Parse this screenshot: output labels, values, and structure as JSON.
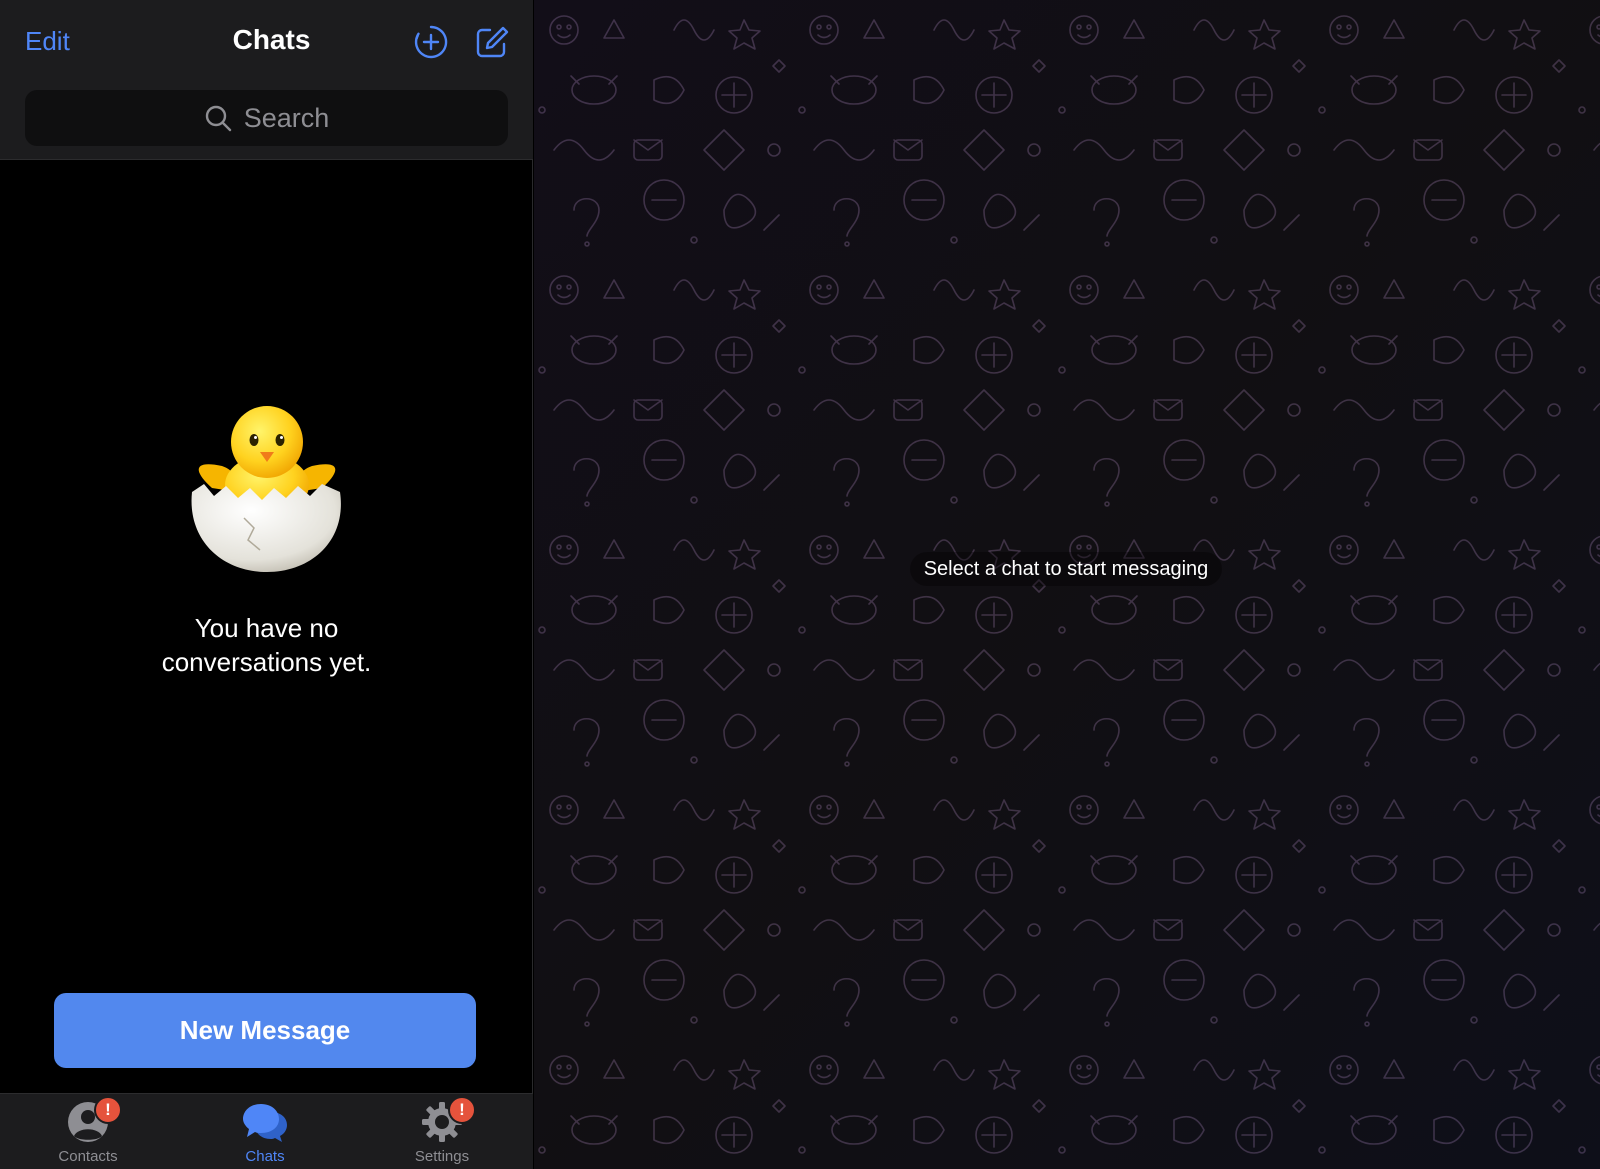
{
  "header": {
    "edit_label": "Edit",
    "title": "Chats",
    "new_story_icon": "plus-circle-icon",
    "compose_icon": "compose-icon"
  },
  "search": {
    "placeholder": "Search"
  },
  "empty_state": {
    "illustration": "hatching-chick",
    "message": "You have no\nconversations yet."
  },
  "new_message_button": "New Message",
  "tabs": [
    {
      "label": "Contacts",
      "icon": "person-icon",
      "badge": "!",
      "active": false
    },
    {
      "label": "Chats",
      "icon": "chat-bubbles-icon",
      "badge": "",
      "active": true
    },
    {
      "label": "Settings",
      "icon": "gear-icon",
      "badge": "!",
      "active": false
    }
  ],
  "main": {
    "placeholder_text": "Select a chat to start messaging"
  },
  "colors": {
    "accent": "#4f86f7",
    "button": "#5288ee",
    "badge": "#e5533c",
    "background": "#000000",
    "bar": "#1c1c1e"
  }
}
